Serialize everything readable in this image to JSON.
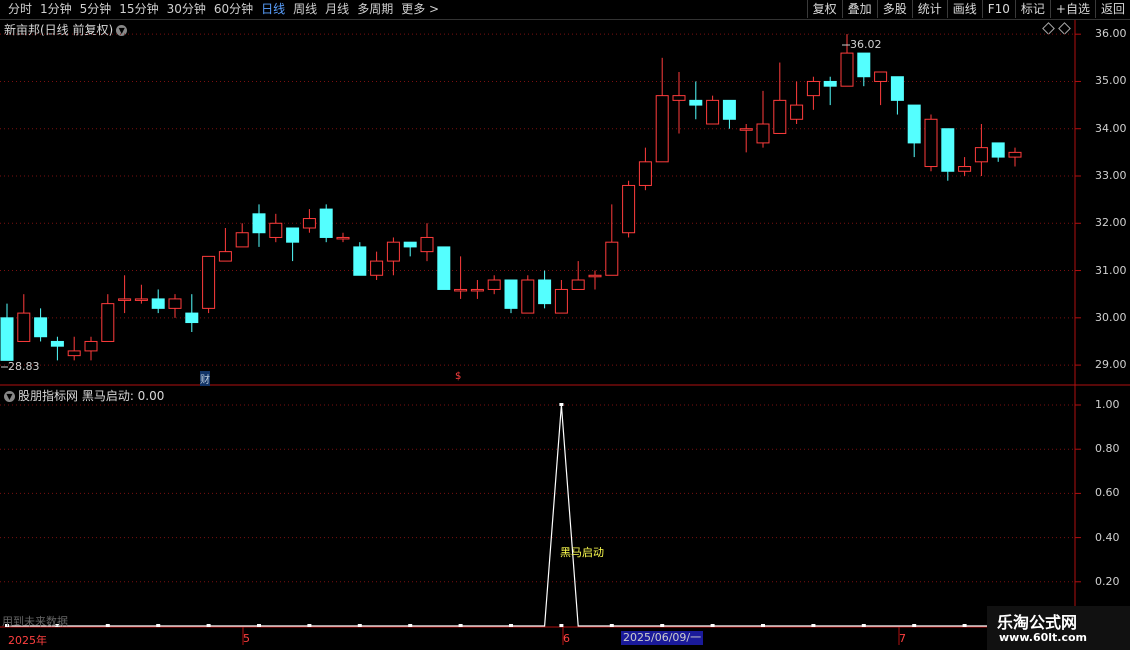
{
  "toolbar": {
    "periods": [
      "分时",
      "1分钟",
      "5分钟",
      "15分钟",
      "30分钟",
      "60分钟",
      "日线",
      "周线",
      "月线",
      "多周期",
      "更多 >"
    ],
    "active_period": "日线",
    "right_buttons": [
      "复权",
      "叠加",
      "多股",
      "统计",
      "画线",
      "F10",
      "标记",
      "+自选",
      "返回"
    ]
  },
  "main_title": "新亩邦(日线 前复权)",
  "indicator_title": "股朋指标网 黑马启动: 0.00",
  "indicator_label": "黑马启动",
  "future_text": "用到未来数据",
  "price_high_label": "36.02",
  "price_low_label": "28.83",
  "price_axis": [
    "36.00",
    "35.00",
    "34.00",
    "33.00",
    "32.00",
    "31.00",
    "30.00",
    "29.00"
  ],
  "ind_axis": [
    "1.00",
    "0.80",
    "0.60",
    "0.40",
    "0.20"
  ],
  "date_labels": {
    "year": "2025年",
    "m5": "5",
    "m6": "6",
    "m7": "7",
    "cursor_date": "2025/06/09/一"
  },
  "markers": {
    "cai": "财",
    "dollar": "$"
  },
  "watermark": {
    "line1": "乐淘公式网",
    "line2": "www.60lt.com"
  },
  "colors": {
    "up": "#ff3c3c",
    "down": "#54ffff",
    "axis": "#b01010",
    "grid": "#7a1010"
  },
  "chart_data": {
    "type": "candlestick",
    "y_range": [
      28.6,
      36.3
    ],
    "candles": [
      [
        30.0,
        29.1,
        29.1,
        30.3
      ],
      [
        29.5,
        30.1,
        29.9,
        30.5
      ],
      [
        30.0,
        29.6,
        29.5,
        30.2
      ],
      [
        29.5,
        29.4,
        29.1,
        29.6
      ],
      [
        29.2,
        29.3,
        29.1,
        29.6
      ],
      [
        29.3,
        29.5,
        29.1,
        29.6
      ],
      [
        29.5,
        30.3,
        29.5,
        30.5
      ],
      [
        30.4,
        30.4,
        30.1,
        30.9
      ],
      [
        30.4,
        30.4,
        30.3,
        30.7
      ],
      [
        30.4,
        30.2,
        30.1,
        30.6
      ],
      [
        30.2,
        30.4,
        30.0,
        30.5
      ],
      [
        30.1,
        29.9,
        29.7,
        30.5
      ],
      [
        30.2,
        31.3,
        30.1,
        31.3
      ],
      [
        31.2,
        31.4,
        31.2,
        31.9
      ],
      [
        31.5,
        31.8,
        31.5,
        32.0
      ],
      [
        32.2,
        31.8,
        31.5,
        32.4
      ],
      [
        31.7,
        32.0,
        31.6,
        32.2
      ],
      [
        31.9,
        31.6,
        31.2,
        31.9
      ],
      [
        31.9,
        32.1,
        31.8,
        32.3
      ],
      [
        32.3,
        31.7,
        31.6,
        32.4
      ],
      [
        31.7,
        31.7,
        31.6,
        31.8
      ],
      [
        31.5,
        30.9,
        30.9,
        31.6
      ],
      [
        30.9,
        31.2,
        30.8,
        31.4
      ],
      [
        31.2,
        31.6,
        30.9,
        31.7
      ],
      [
        31.6,
        31.5,
        31.3,
        31.6
      ],
      [
        31.4,
        31.7,
        31.2,
        32.0
      ],
      [
        31.5,
        30.6,
        30.6,
        31.5
      ],
      [
        30.6,
        30.6,
        30.4,
        31.3
      ],
      [
        30.6,
        30.6,
        30.4,
        30.8
      ],
      [
        30.6,
        30.8,
        30.5,
        30.9
      ],
      [
        30.8,
        30.2,
        30.1,
        30.8
      ],
      [
        30.1,
        30.8,
        30.1,
        30.9
      ],
      [
        30.8,
        30.3,
        30.2,
        31.0
      ],
      [
        30.1,
        30.6,
        30.1,
        30.8
      ],
      [
        30.6,
        30.8,
        30.6,
        31.2
      ],
      [
        30.9,
        30.9,
        30.6,
        31.0
      ],
      [
        30.9,
        31.6,
        30.9,
        32.4
      ],
      [
        31.8,
        32.8,
        31.7,
        32.9
      ],
      [
        32.8,
        33.3,
        32.7,
        33.6
      ],
      [
        33.3,
        34.7,
        33.3,
        35.5
      ],
      [
        34.6,
        34.7,
        33.9,
        35.2
      ],
      [
        34.6,
        34.5,
        34.2,
        35.0
      ],
      [
        34.1,
        34.6,
        34.1,
        34.7
      ],
      [
        34.6,
        34.2,
        34.0,
        34.6
      ],
      [
        34.0,
        34.0,
        33.5,
        34.1
      ],
      [
        33.7,
        34.1,
        33.6,
        34.8
      ],
      [
        33.9,
        34.6,
        33.9,
        35.4
      ],
      [
        34.2,
        34.5,
        34.1,
        35.0
      ],
      [
        34.7,
        35.0,
        34.4,
        35.1
      ],
      [
        35.0,
        34.9,
        34.5,
        35.1
      ],
      [
        34.9,
        35.6,
        34.9,
        36.0
      ],
      [
        35.6,
        35.1,
        34.9,
        35.6
      ],
      [
        35.0,
        35.2,
        34.5,
        35.2
      ],
      [
        35.1,
        34.6,
        34.3,
        35.1
      ],
      [
        34.5,
        33.7,
        33.4,
        34.5
      ],
      [
        33.2,
        34.2,
        33.1,
        34.3
      ],
      [
        34.0,
        33.1,
        32.9,
        34.0
      ],
      [
        33.1,
        33.2,
        33.0,
        33.4
      ],
      [
        33.3,
        33.6,
        33.0,
        34.1
      ],
      [
        33.7,
        33.4,
        33.3,
        33.7
      ],
      [
        33.4,
        33.5,
        33.2,
        33.6
      ]
    ],
    "indicator": {
      "name": "黑马启动",
      "spike_index": 33,
      "values_before": 0,
      "spike_value": 1,
      "y_range": [
        0,
        1.1
      ]
    }
  }
}
